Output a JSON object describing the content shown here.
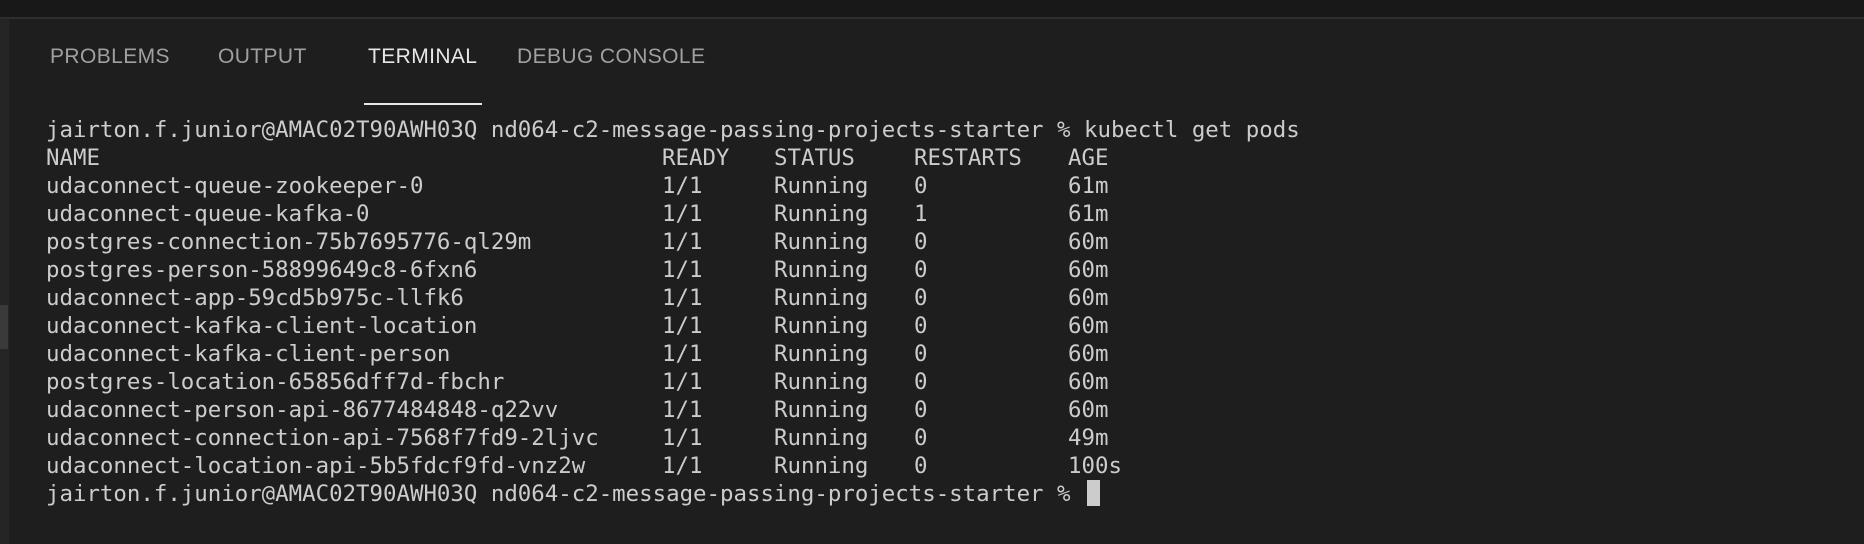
{
  "panel": {
    "tabs": [
      {
        "label": "PROBLEMS",
        "active": false
      },
      {
        "label": "OUTPUT",
        "active": false
      },
      {
        "label": "TERMINAL",
        "active": true
      },
      {
        "label": "DEBUG CONSOLE",
        "active": false
      }
    ]
  },
  "terminal": {
    "prompt": "jairton.f.junior@AMAC02T90AWH03Q nd064-c2-message-passing-projects-starter % ",
    "command": "kubectl get pods",
    "headers": {
      "name": "NAME",
      "ready": "READY",
      "status": "STATUS",
      "restarts": "RESTARTS",
      "age": "AGE"
    },
    "rows": [
      {
        "name": "udaconnect-queue-zookeeper-0",
        "ready": "1/1",
        "status": "Running",
        "restarts": "0",
        "age": "61m"
      },
      {
        "name": "udaconnect-queue-kafka-0",
        "ready": "1/1",
        "status": "Running",
        "restarts": "1",
        "age": "61m"
      },
      {
        "name": "postgres-connection-75b7695776-ql29m",
        "ready": "1/1",
        "status": "Running",
        "restarts": "0",
        "age": "60m"
      },
      {
        "name": "postgres-person-58899649c8-6fxn6",
        "ready": "1/1",
        "status": "Running",
        "restarts": "0",
        "age": "60m"
      },
      {
        "name": "udaconnect-app-59cd5b975c-llfk6",
        "ready": "1/1",
        "status": "Running",
        "restarts": "0",
        "age": "60m"
      },
      {
        "name": "udaconnect-kafka-client-location",
        "ready": "1/1",
        "status": "Running",
        "restarts": "0",
        "age": "60m"
      },
      {
        "name": "udaconnect-kafka-client-person",
        "ready": "1/1",
        "status": "Running",
        "restarts": "0",
        "age": "60m"
      },
      {
        "name": "postgres-location-65856dff7d-fbchr",
        "ready": "1/1",
        "status": "Running",
        "restarts": "0",
        "age": "60m"
      },
      {
        "name": "udaconnect-person-api-8677484848-q22vv",
        "ready": "1/1",
        "status": "Running",
        "restarts": "0",
        "age": "60m"
      },
      {
        "name": "udaconnect-connection-api-7568f7fd9-2ljvc",
        "ready": "1/1",
        "status": "Running",
        "restarts": "0",
        "age": "49m"
      },
      {
        "name": "udaconnect-location-api-5b5fdcf9fd-vnz2w",
        "ready": "1/1",
        "status": "Running",
        "restarts": "0",
        "age": "100s"
      }
    ],
    "final_prompt": "jairton.f.junior@AMAC02T90AWH03Q nd064-c2-message-passing-projects-starter % "
  },
  "colors": {
    "background": "#1e1e1e",
    "text": "#cccccc",
    "tab_inactive": "#a0a0a0",
    "tab_active": "#e7e7e7"
  }
}
